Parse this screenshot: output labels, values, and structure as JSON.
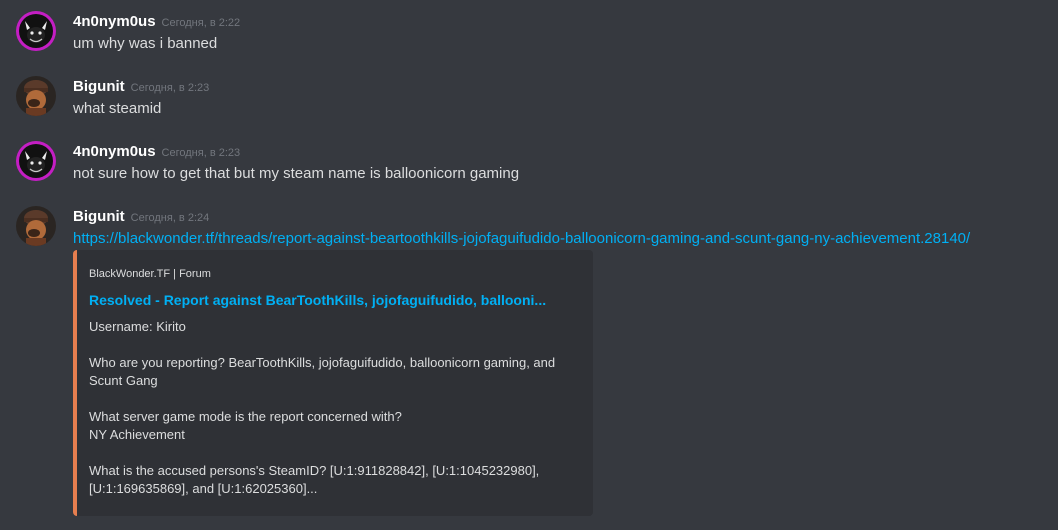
{
  "messages": [
    {
      "username": "4n0nym0us",
      "timestamp": "Сегодня, в 2:22",
      "text": "um why was i banned",
      "avatar": "demon-avatar-icon"
    },
    {
      "username": "Bigunit",
      "timestamp": "Сегодня, в 2:23",
      "text": "what steamid",
      "avatar": "soldier-avatar-icon"
    },
    {
      "username": "4n0nym0us",
      "timestamp": "Сегодня, в 2:23",
      "text": "not sure how to get that but my steam name is balloonicorn gaming",
      "avatar": "demon-avatar-icon"
    },
    {
      "username": "Bigunit",
      "timestamp": "Сегодня, в 2:24",
      "link": "https://blackwonder.tf/threads/report-against-beartoothkills-jojofaguifudido-balloonicorn-gaming-and-scunt-gang-ny-achievement.28140/",
      "avatar": "soldier-avatar-icon"
    }
  ],
  "embed": {
    "accent_color": "#e67e4f",
    "provider": "BlackWonder.TF | Forum",
    "title": "Resolved - Report against BearToothKills, jojofaguifudido, ballooni...",
    "paragraphs": [
      [
        "Username: Kirito"
      ],
      [
        "Who are you reporting? BearToothKills, jojofaguifudido, balloonicorn gaming, and",
        "Scunt Gang"
      ],
      [
        "What server game mode is the report concerned with?",
        "NY Achievement"
      ],
      [
        "What is the accused persons's SteamID? [U:1:911828842], [U:1:1045232980],",
        "[U:1:169635869], and [U:1:62025360]..."
      ]
    ]
  },
  "colors": {
    "background": "#36393f",
    "link": "#00b0f4",
    "username": "#ffffff",
    "timestamp": "#72767d"
  }
}
